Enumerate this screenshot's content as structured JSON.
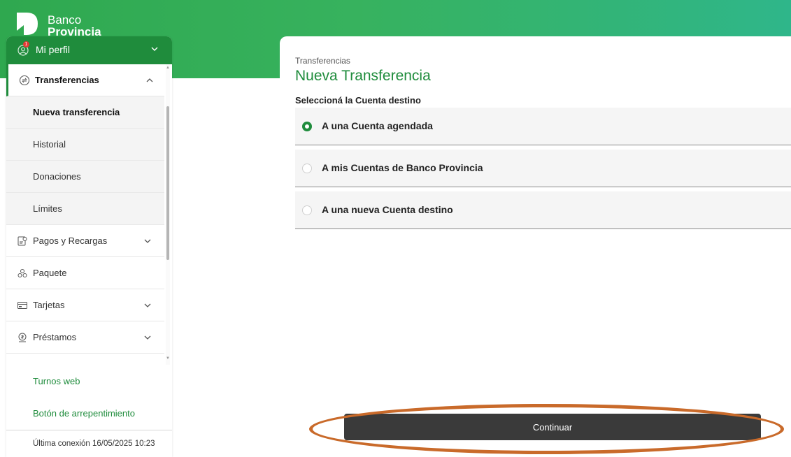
{
  "brand": {
    "line1": "Banco",
    "line2": "Provincia"
  },
  "profile": {
    "label": "Mi perfil",
    "badge": "1"
  },
  "sidebar": {
    "items": [
      {
        "label": "Transferencias",
        "icon": "transfer-icon",
        "expanded": true
      },
      {
        "label": "Pagos y Recargas",
        "icon": "payments-icon"
      },
      {
        "label": "Paquete",
        "icon": "package-icon"
      },
      {
        "label": "Tarjetas",
        "icon": "card-icon"
      },
      {
        "label": "Préstamos",
        "icon": "loan-icon"
      }
    ],
    "subitems": [
      {
        "label": "Nueva transferencia",
        "selected": true
      },
      {
        "label": "Historial"
      },
      {
        "label": "Donaciones"
      },
      {
        "label": "Límites"
      }
    ],
    "links": [
      {
        "label": "Turnos web"
      },
      {
        "label": "Botón de arrepentimiento"
      }
    ],
    "last_connection": "Última conexión 16/05/2025 10:23"
  },
  "main": {
    "breadcrumb": "Transferencias",
    "title": "Nueva Transferencia",
    "section_label": "Seleccioná la Cuenta destino",
    "options": [
      {
        "label": "A una Cuenta agendada",
        "checked": true
      },
      {
        "label": "A mis Cuentas de Banco Provincia",
        "checked": false
      },
      {
        "label": "A una nueva Cuenta destino",
        "checked": false
      }
    ],
    "continue_label": "Continuar"
  },
  "colors": {
    "brand_green": "#1f8c3c",
    "button_dark": "#3a3a3a",
    "highlight": "#c96a2a"
  }
}
